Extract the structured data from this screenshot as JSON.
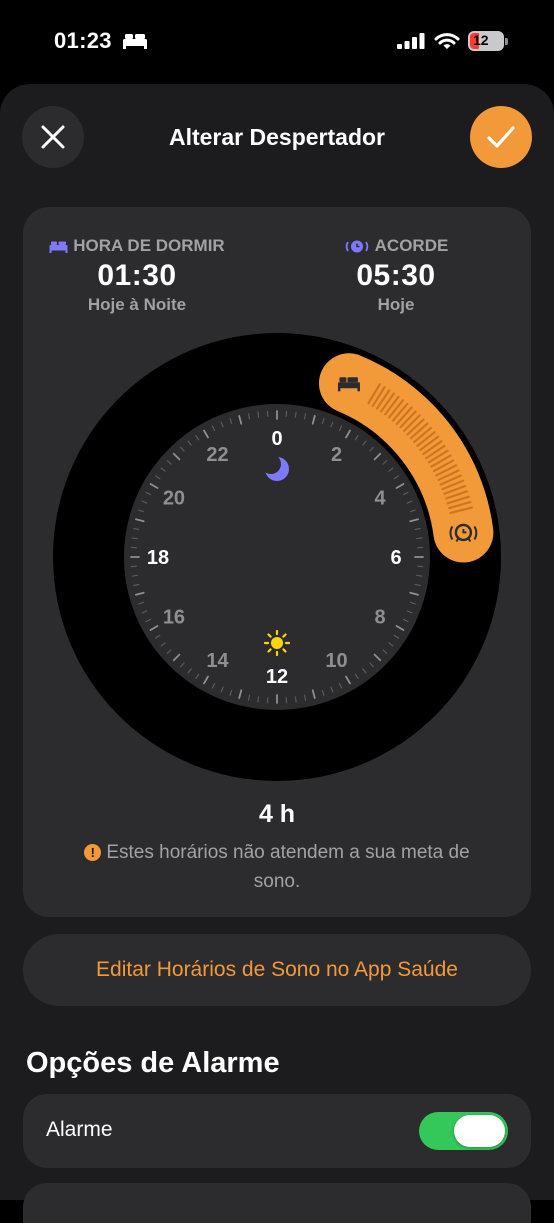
{
  "status_bar": {
    "time": "01:23",
    "battery": "12",
    "icons": [
      "bed-icon",
      "cellular-signal-icon",
      "wifi-icon",
      "battery-icon"
    ]
  },
  "header": {
    "title": "Alterar Despertador",
    "close_icon": "close-icon",
    "confirm_icon": "checkmark-icon"
  },
  "schedule": {
    "bedtime": {
      "label": "HORA DE DORMIR",
      "time": "01:30",
      "day": "Hoje à Noite",
      "icon": "bed-icon"
    },
    "wake": {
      "label": "ACORDE",
      "time": "05:30",
      "day": "Hoje",
      "icon": "alarm-icon"
    }
  },
  "clock": {
    "hour_labels": [
      "0",
      "2",
      "4",
      "6",
      "8",
      "10",
      "12",
      "14",
      "16",
      "18",
      "20",
      "22"
    ],
    "start_hour": 1.5,
    "end_hour": 5.5,
    "colors": {
      "accent": "#f2993a",
      "moon": "#7d7aff",
      "sun": "#ffd60a"
    }
  },
  "summary": {
    "duration": "4 h",
    "warning_icon": "!",
    "warning": "Estes horários não atendem a sua meta de sono."
  },
  "edit_button": "Editar Horários de Sono no App Saúde",
  "alarm_options": {
    "title": "Opções de Alarme",
    "alarm_label": "Alarme",
    "alarm_enabled": true
  }
}
